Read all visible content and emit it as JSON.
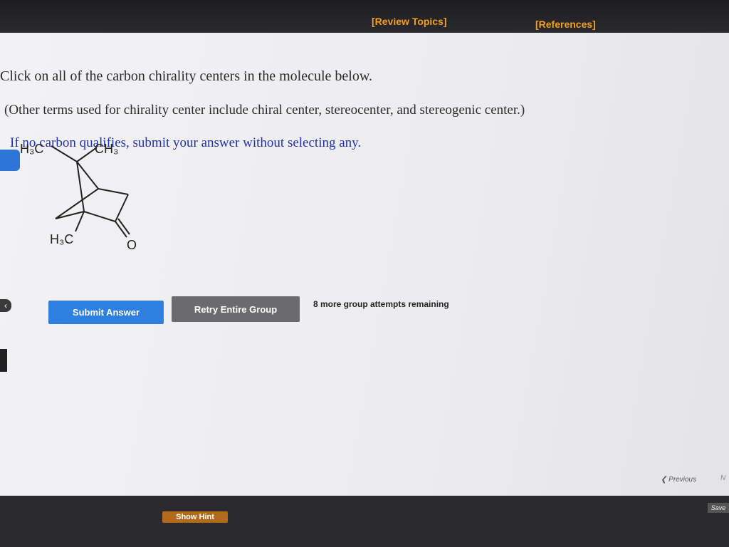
{
  "header": {
    "review_topics": "[Review Topics]",
    "references": "[References]"
  },
  "question": {
    "line1": "Click on all of the carbon chirality centers in the molecule below.",
    "line2": "(Other terms used for chirality center include chiral center, stereocenter, and stereogenic center.)",
    "line3": "If no carbon qualifies, submit your answer without selecting any."
  },
  "molecule": {
    "label_h3c_top": "H₃C",
    "label_ch3_top": "CH₃",
    "label_h3c_bottom": "H₃C",
    "label_oxygen": "O"
  },
  "actions": {
    "submit_label": "Submit Answer",
    "retry_label": "Retry Entire Group",
    "attempts_text": "8 more group attempts remaining"
  },
  "footer": {
    "hint_label": "Show Hint",
    "previous_label": "Previous",
    "next_label": "N",
    "save_label": "Save"
  },
  "colors": {
    "accent_orange": "#f3a020",
    "submit_blue": "#2f7fe0",
    "retry_gray": "#6b6b6d",
    "instruction_blue": "#2431a8"
  }
}
